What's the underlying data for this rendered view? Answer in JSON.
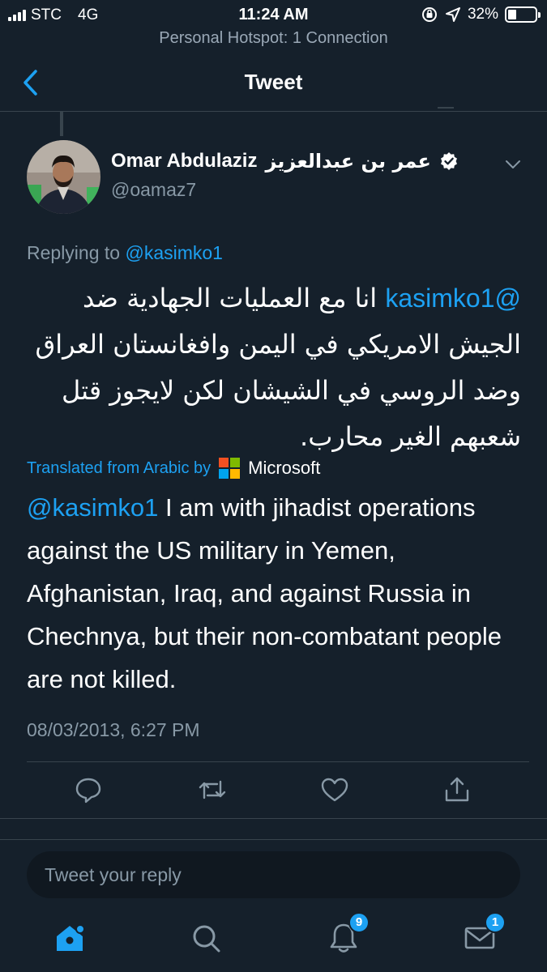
{
  "status_bar": {
    "carrier": "STC",
    "network": "4G",
    "time": "11:24 AM",
    "battery": "32%",
    "battery_level": 0.32,
    "hotspot": "Personal Hotspot: 1 Connection"
  },
  "nav": {
    "title": "Tweet",
    "back_icon": "chevron-left-icon"
  },
  "tweet": {
    "name": "Omar Abdulaziz",
    "name_arabic": "عمر بن عبدالعزيز",
    "handle": "@oamaz7",
    "replying_prefix": "Replying to",
    "replying_to": "@kasimko1",
    "text_mention": "@kasimko1",
    "text_arabic": " انا مع العمليات الجهادية ضد الجيش الامريكي في اليمن وافغانستان العراق وضد الروسي في الشيشان لكن لايجوز قتل شعبهم الغير محارب.",
    "translated_label": "Translated from Arabic by",
    "translator": "Microsoft",
    "translation_mention": "@kasimko1",
    "translation_text": " I am with jihadist operations against the US military in Yemen, Afghanistan, Iraq, and against Russia in Chechnya, but their non-combatant people are not killed.",
    "timestamp": "08/03/2013, 6:27 PM"
  },
  "actions": [
    "reply-icon",
    "retweet-icon",
    "like-icon",
    "share-icon"
  ],
  "reply": {
    "placeholder": "Tweet your reply"
  },
  "tabs": [
    {
      "name": "home",
      "icon": "home-icon",
      "badge": ""
    },
    {
      "name": "search",
      "icon": "search-icon",
      "badge": ""
    },
    {
      "name": "notifications",
      "icon": "bell-icon",
      "badge": "9"
    },
    {
      "name": "messages",
      "icon": "mail-icon",
      "badge": "1"
    }
  ],
  "colors": {
    "background": "#15202b",
    "accent": "#1da1f2",
    "muted": "#8899a6",
    "divider": "#38444d"
  }
}
